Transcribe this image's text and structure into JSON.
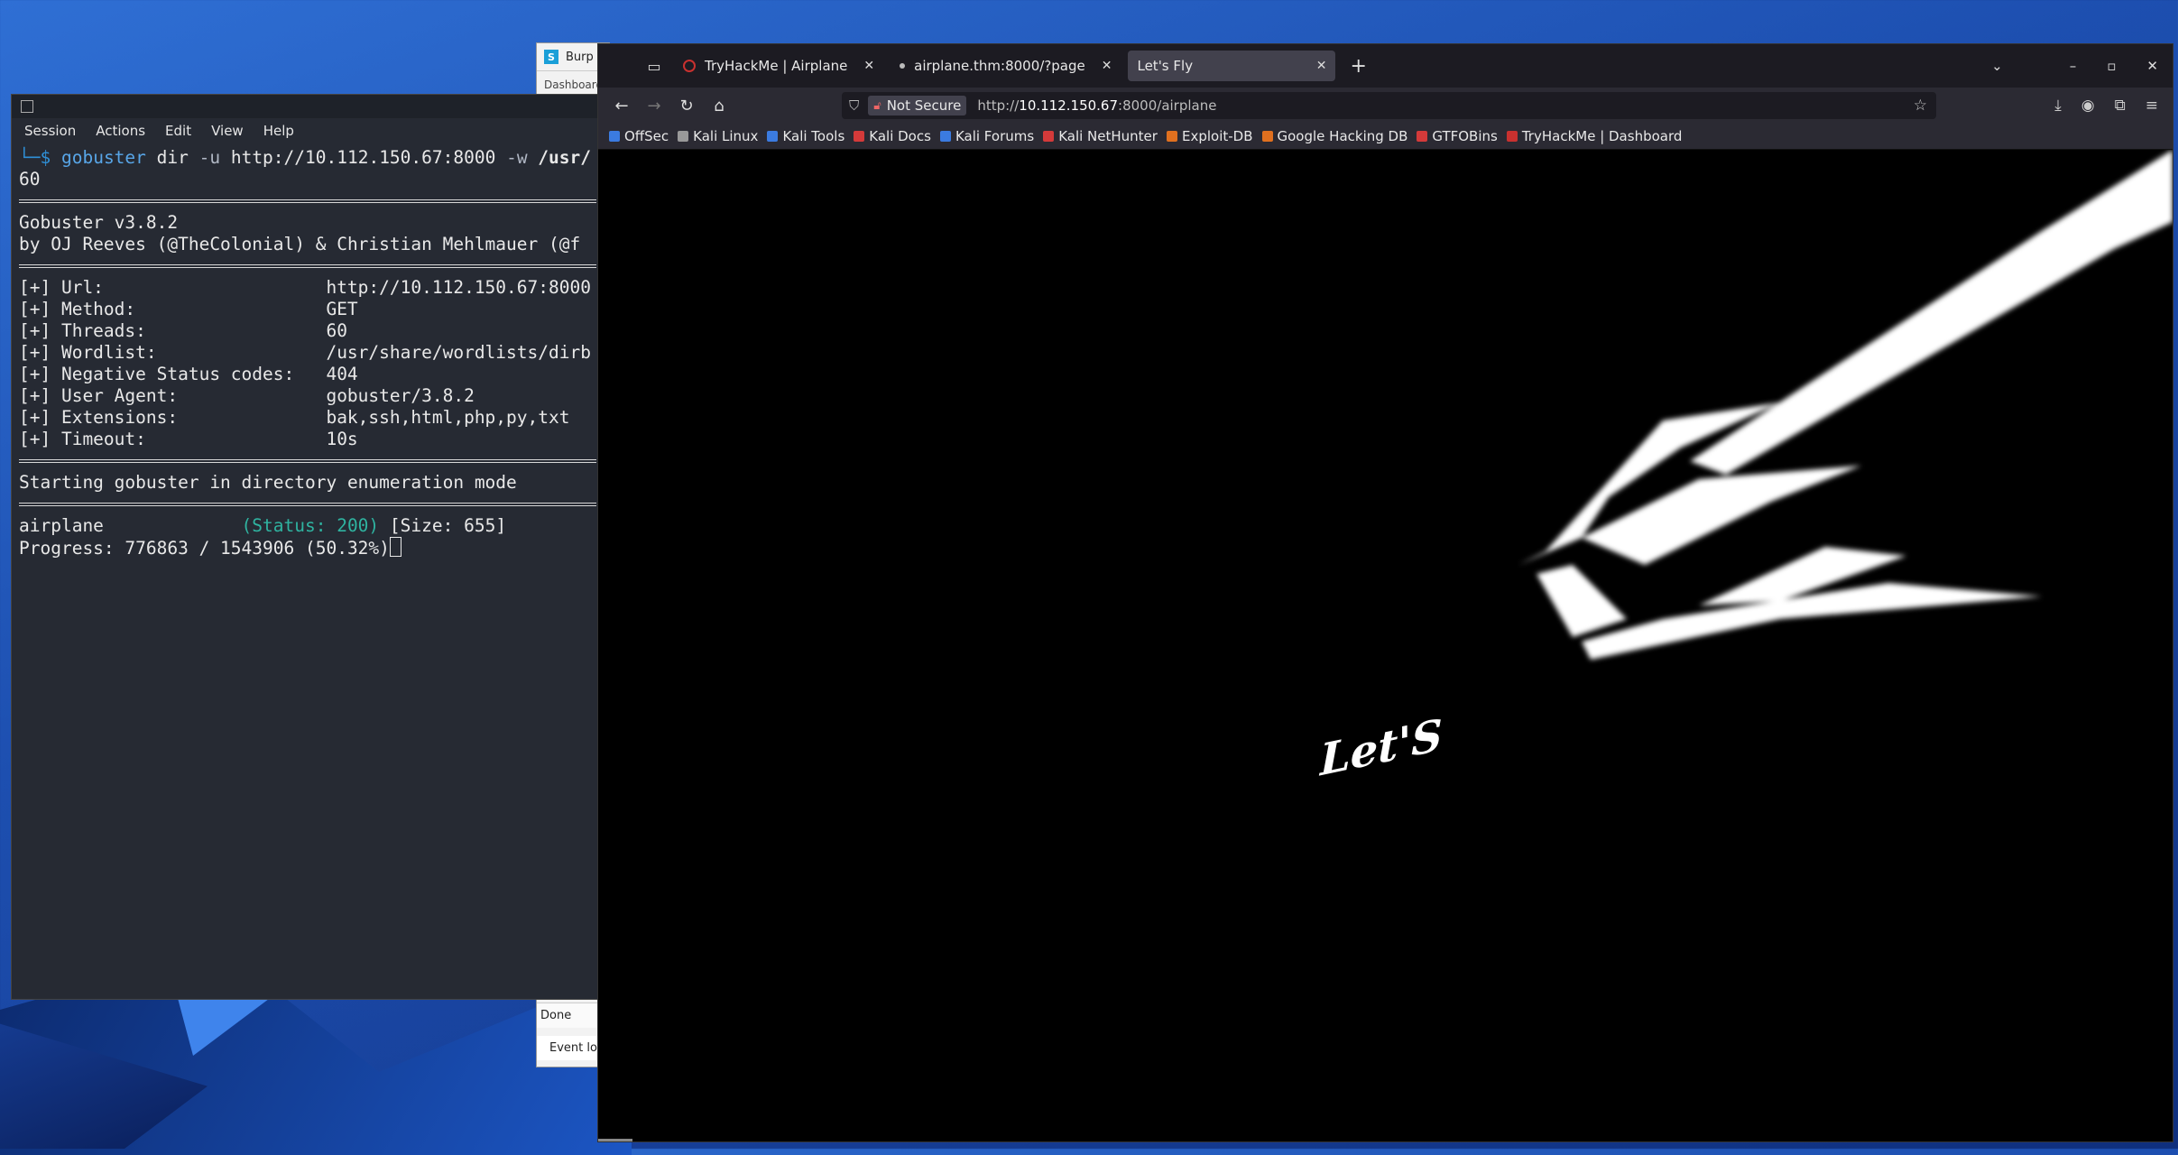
{
  "burp": {
    "title": "Burp",
    "tab": "Dashboard",
    "status": "Done",
    "event_log": "Event log"
  },
  "terminal": {
    "menu": [
      "Session",
      "Actions",
      "Edit",
      "View",
      "Help"
    ],
    "prompt": "└─$",
    "cmd": "gobuster",
    "cmd_rest": " dir ",
    "flag_u": "-u",
    "url_arg": " http://10.112.150.67:8000 ",
    "flag_w": "-w",
    "wordlist_arg": " /usr/",
    "line_60": "60",
    "version": "Gobuster v3.8.2",
    "authors": "by OJ Reeves (@TheColonial) & Christian Mehlmauer (@f",
    "config": [
      {
        "key": "[+] Url:",
        "value": "http://10.112.150.67:8000"
      },
      {
        "key": "[+] Method:",
        "value": "GET"
      },
      {
        "key": "[+] Threads:",
        "value": "60"
      },
      {
        "key": "[+] Wordlist:",
        "value": "/usr/share/wordlists/dirb"
      },
      {
        "key": "[+] Negative Status codes:",
        "value": "404"
      },
      {
        "key": "[+] User Agent:",
        "value": "gobuster/3.8.2"
      },
      {
        "key": "[+] Extensions:",
        "value": "bak,ssh,html,php,py,txt"
      },
      {
        "key": "[+] Timeout:",
        "value": "10s"
      }
    ],
    "starting": "Starting gobuster in directory enumeration mode",
    "result_name": "airplane",
    "result_status": "(Status: 200)",
    "result_size": "[Size: 655]",
    "progress": "Progress: 776863 / 1543906 (50.32%)"
  },
  "browser": {
    "tabs": [
      {
        "label": "TryHackMe | Airplane",
        "active": false
      },
      {
        "label": "airplane.thm:8000/?page",
        "active": false
      },
      {
        "label": "Let's Fly",
        "active": true
      }
    ],
    "not_secure": "Not Secure",
    "url_prefix": "http://",
    "url_host": "10.112.150.67",
    "url_rest": ":8000/airplane",
    "bookmarks": [
      {
        "label": "OffSec",
        "color": "#3b7be0"
      },
      {
        "label": "Kali Linux",
        "color": "#999999"
      },
      {
        "label": "Kali Tools",
        "color": "#3b7be0"
      },
      {
        "label": "Kali Docs",
        "color": "#d43a3a"
      },
      {
        "label": "Kali Forums",
        "color": "#3b7be0"
      },
      {
        "label": "Kali NetHunter",
        "color": "#d43a3a"
      },
      {
        "label": "Exploit-DB",
        "color": "#e0701f"
      },
      {
        "label": "Google Hacking DB",
        "color": "#e0701f"
      },
      {
        "label": "GTFOBins",
        "color": "#d43a3a"
      },
      {
        "label": "TryHackMe | Dashboard",
        "color": "#c9312f"
      }
    ],
    "page_text": "Let'S"
  }
}
